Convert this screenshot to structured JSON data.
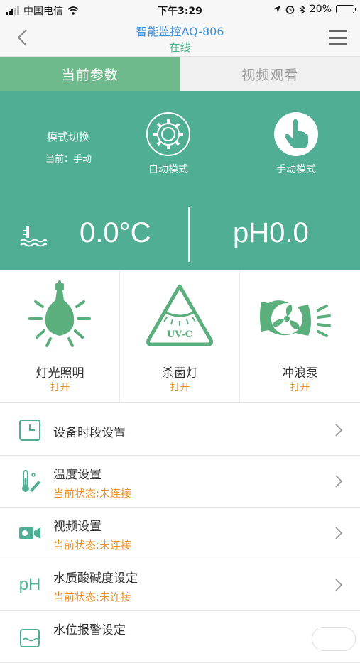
{
  "status_bar": {
    "carrier": "中国电信",
    "time": "下午3:29",
    "battery_percent": "20%",
    "battery_level": 0.2,
    "icons": [
      "signal-icon",
      "wifi-icon",
      "location-icon",
      "alarm-icon",
      "bluetooth-icon",
      "battery-icon"
    ]
  },
  "nav": {
    "title": "智能监控AQ-806",
    "subtitle": "在线",
    "back_icon": "chevron-left-icon",
    "menu_icon": "hamburger-menu-icon"
  },
  "tabs": [
    {
      "label": "当前参数",
      "active": true
    },
    {
      "label": "视频观看",
      "active": false
    }
  ],
  "mode": {
    "label": "模式切换",
    "current": "当前：手动",
    "auto_label": "自动模式",
    "manual_label": "手动模式",
    "selected": "manual"
  },
  "readings": {
    "temperature": "0.0°C",
    "ph": "pH0.0"
  },
  "devices": [
    {
      "name": "灯光照明",
      "state": "打开",
      "icon": "light-bulb-icon"
    },
    {
      "name": "杀菌灯",
      "state": "打开",
      "icon": "uv-lamp-icon",
      "icon_text": "UV-C"
    },
    {
      "name": "冲浪泵",
      "state": "打开",
      "icon": "wave-pump-icon"
    }
  ],
  "settings": [
    {
      "title": "设备时段设置",
      "status": "",
      "icon": "clock-icon"
    },
    {
      "title": "温度设置",
      "status": "当前状态:未连接",
      "icon": "thermometer-icon"
    },
    {
      "title": "视频设置",
      "status": "当前状态:未连接",
      "icon": "video-camera-icon"
    },
    {
      "title": "水质酸碱度设定",
      "status": "当前状态:未连接",
      "icon": "ph-icon",
      "icon_text": "pH"
    },
    {
      "title": "水位报警设定",
      "status": "",
      "icon": "water-level-icon"
    }
  ],
  "colors": {
    "accent_green": "#4fae94",
    "tab_green": "#6fba8c",
    "status_orange": "#e8912a",
    "title_blue": "#3a8fd8"
  }
}
